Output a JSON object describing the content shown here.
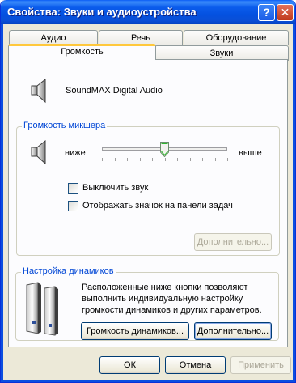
{
  "window": {
    "title": "Свойства: Звуки и аудиоустройства",
    "help_glyph": "?",
    "close_glyph": "✕"
  },
  "tabs": {
    "row_back": [
      "Аудио",
      "Речь",
      "Оборудование"
    ],
    "row_front": [
      "Громкость",
      "Звуки"
    ],
    "active": "Громкость"
  },
  "device": {
    "name": "SoundMAX Digital Audio"
  },
  "mixer": {
    "group_title": "Громкость микшера",
    "low_label": "ниже",
    "high_label": "выше",
    "volume_level": 0.5,
    "mute_label": "Выключить звук",
    "mute_checked": false,
    "tray_icon_label": "Отображать значок на панели задач",
    "tray_icon_checked": false,
    "advanced_label": "Дополнительно..."
  },
  "speakers": {
    "group_title": "Настройка динамиков",
    "description_lines": [
      "Расположенные ниже кнопки позволяют",
      "выполнить индивидуальную настройку",
      "громкости динамиков и других параметров."
    ],
    "volume_button": "Громкость динамиков...",
    "advanced_button": "Дополнительно..."
  },
  "footer": {
    "ok": "ОК",
    "cancel": "Отмена",
    "apply": "Применить"
  },
  "colors": {
    "title_bar": "#0a5cf5",
    "group_title": "#0046d5",
    "active_tab_highlight": "#ffc83c"
  }
}
